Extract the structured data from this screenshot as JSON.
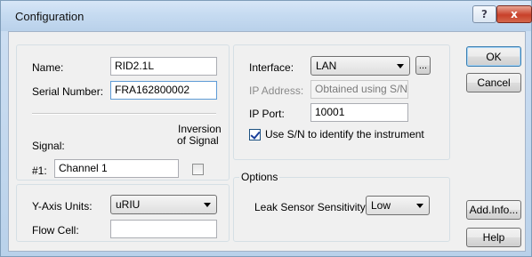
{
  "window": {
    "title": "Configuration",
    "help_button": "?",
    "close_button": "x"
  },
  "identity": {
    "name_label": "Name:",
    "name_value": "RID2.1L",
    "serial_label": "Serial Number:",
    "serial_value": "FRA162800002",
    "signal_label": "Signal:",
    "inversion_label_1": "Inversion",
    "inversion_label_2": "of Signal",
    "channel_prefix": "#1:",
    "channel_value": "Channel 1",
    "inversion_checked": false
  },
  "axis": {
    "y_units_label": "Y-Axis Units:",
    "y_units_value": "uRIU",
    "flow_cell_label": "Flow Cell:",
    "flow_cell_value": ""
  },
  "connection": {
    "interface_label": "Interface:",
    "interface_value": "LAN",
    "browse_label": "...",
    "ip_label": "IP Address:",
    "ip_value": "Obtained using S/N",
    "port_label": "IP Port:",
    "port_value": "10001",
    "use_sn_label": "Use S/N to identify the instrument",
    "use_sn_checked": true
  },
  "options": {
    "caption": "Options",
    "leak_label": "Leak Sensor Sensitivity:",
    "leak_value": "Low"
  },
  "buttons": {
    "ok": "OK",
    "cancel": "Cancel",
    "add_info": "Add.Info...",
    "help": "Help"
  },
  "colors": {
    "title_gradient": "#c6dbf1",
    "close_red": "#c8402a",
    "focus_border": "#5e9bd6"
  }
}
